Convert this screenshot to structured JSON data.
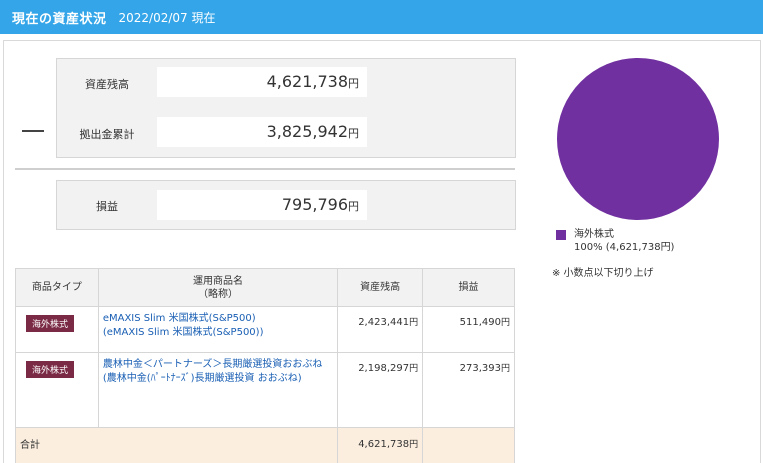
{
  "header": {
    "title": "現在の資産状況",
    "date": "2022/02/07 現在"
  },
  "summary": {
    "balance": {
      "label": "資産残高",
      "value": "4,621,738",
      "unit": "円"
    },
    "contribution": {
      "label": "拠出金累計",
      "value": "3,825,942",
      "unit": "円"
    },
    "profit": {
      "label": "損益",
      "value": "795,796",
      "unit": "円"
    }
  },
  "table": {
    "headers": {
      "type": "商品タイプ",
      "name": "運用商品名\n（略称）",
      "balance": "資産残高",
      "profit": "損益"
    },
    "rows": [
      {
        "type": "海外株式",
        "name": "eMAXIS Slim 米国株式(S&P500)",
        "short": "(eMAXIS Slim 米国株式(S&P500))",
        "balance": "2,423,441",
        "profit": "511,490",
        "unit": "円"
      },
      {
        "type": "海外株式",
        "name": "農林中金＜パートナーズ＞長期厳選投資おおぶね",
        "short": "(農林中金(ﾊﾟｰﾄﾅｰｽﾞ)長期厳選投資 おおぶね)",
        "balance": "2,198,297",
        "profit": "273,393",
        "unit": "円"
      }
    ],
    "total": {
      "label": "合計",
      "balance": "4,621,738",
      "unit": "円"
    }
  },
  "chart_data": {
    "type": "pie",
    "slices": [
      {
        "label": "海外株式",
        "percent": 100,
        "value": 4621738,
        "color": "#7030a0"
      }
    ]
  },
  "legend": {
    "name": "海外株式",
    "detail": "100% (4,621,738円)",
    "color": "#7030a0"
  },
  "note": "※ 小数点以下切り上げ"
}
